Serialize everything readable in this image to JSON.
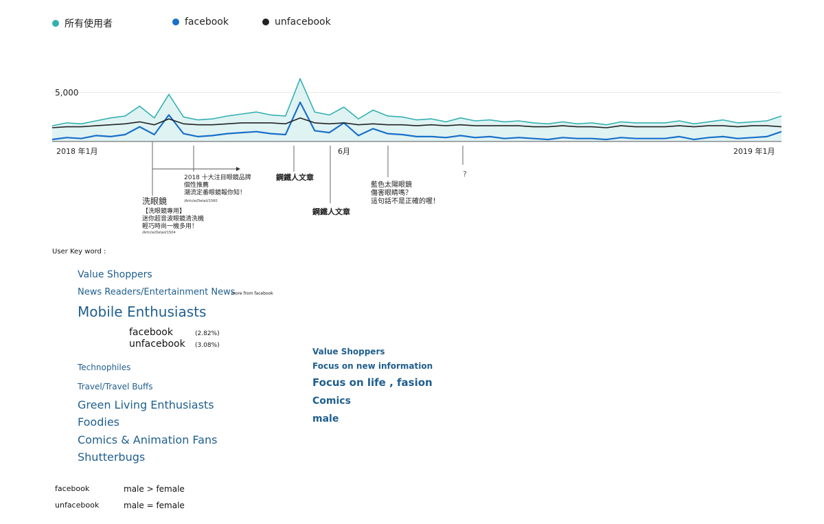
{
  "legend": [
    {
      "label": "所有使用者",
      "color": "#35b0b0"
    },
    {
      "label": "facebook",
      "color": "#1a6fc9"
    },
    {
      "label": "unfacebook",
      "color": "#222222"
    }
  ],
  "chart_data": {
    "type": "line",
    "title": "",
    "xlabel": "",
    "ylabel": "",
    "x_ticks": [
      "2018 年1月",
      "6月",
      "2019 年1月"
    ],
    "y_ticks": [
      "5,000"
    ],
    "ylim": [
      0,
      7000
    ],
    "grid": true,
    "series": [
      {
        "name": "所有使用者",
        "color": "#35b0b0",
        "values": [
          1600,
          1900,
          1800,
          2100,
          2400,
          2600,
          3600,
          2400,
          4800,
          2500,
          2200,
          2300,
          2600,
          2800,
          3000,
          2700,
          2600,
          6400,
          3000,
          2700,
          3500,
          2300,
          3200,
          2600,
          2500,
          2200,
          2300,
          2000,
          2400,
          2100,
          2200,
          2000,
          2100,
          1900,
          1800,
          2000,
          1800,
          1900,
          1700,
          2000,
          1900,
          1900,
          1900,
          2100,
          1800,
          2000,
          2200,
          1900,
          2000,
          2100,
          2600
        ]
      },
      {
        "name": "facebook",
        "color": "#1a6fc9",
        "values": [
          200,
          400,
          300,
          600,
          500,
          700,
          1500,
          700,
          2700,
          800,
          500,
          600,
          800,
          900,
          1000,
          800,
          700,
          4000,
          1100,
          900,
          1900,
          600,
          1300,
          800,
          700,
          500,
          500,
          400,
          600,
          400,
          500,
          300,
          400,
          300,
          200,
          400,
          300,
          300,
          200,
          400,
          300,
          300,
          300,
          500,
          200,
          400,
          500,
          300,
          400,
          500,
          1000
        ]
      },
      {
        "name": "unfacebook",
        "color": "#222222",
        "values": [
          1400,
          1500,
          1500,
          1600,
          1700,
          1800,
          2000,
          1700,
          2300,
          1800,
          1700,
          1700,
          1800,
          1900,
          1900,
          1900,
          1800,
          2400,
          1900,
          1800,
          1900,
          1700,
          1800,
          1700,
          1700,
          1600,
          1700,
          1600,
          1700,
          1600,
          1600,
          1600,
          1600,
          1500,
          1500,
          1600,
          1500,
          1500,
          1400,
          1600,
          1500,
          1500,
          1500,
          1600,
          1500,
          1600,
          1600,
          1500,
          1600,
          1600,
          1500
        ]
      }
    ]
  },
  "annotations": {
    "a1_title": "洗眼鏡",
    "a1_line1": "【洗眼鏡專用】",
    "a1_line2": "迷你超音波眼鏡清洗機",
    "a1_line3": "輕巧時尚一機多用！",
    "a1_path": "/Article/Detail/1504",
    "a2_line1": "2018 十大注目眼鏡品牌",
    "a2_line2": "個性推薦",
    "a2_line3": "潮流定番眼鏡報你知！",
    "a2_path": "/Article/Detail/1560",
    "a3": "鋼鐵人文章",
    "a4": "鋼鐵人文章",
    "a5_line1": "藍色太陽眼鏡",
    "a5_line2": "傷害眼睛嗎？",
    "a5_line3": "這句話不是正確的喔！",
    "a6": "?"
  },
  "keywords": {
    "heading": "User Key word :",
    "left": [
      "Value Shoppers",
      "News Readers/Entertainment News",
      "Mobile Enthusiasts",
      "Technophiles",
      "Travel/Travel Buffs",
      "Green Living Enthusiasts",
      "Foodies",
      "Comics & Animation Fans",
      "Shutterbugs"
    ],
    "more_note": "more from facebook",
    "mobile_fb_label": "facebook",
    "mobile_fb_pct": "(2.82%)",
    "mobile_unfb_label": "unfacebook",
    "mobile_unfb_pct": "(3.08%)",
    "right": [
      "Value Shoppers",
      "Focus on new information",
      "Focus on life , fasion",
      "Comics",
      "male"
    ]
  },
  "gender": [
    {
      "group": "facebook",
      "relation": "male > female"
    },
    {
      "group": "unfacebook",
      "relation": "male = female"
    }
  ]
}
